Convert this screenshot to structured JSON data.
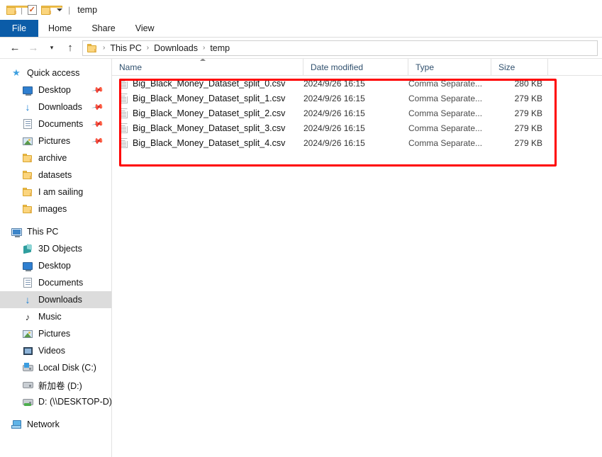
{
  "window": {
    "title": "temp",
    "quick_access_toolbar": [
      {
        "name": "folder-icon",
        "label": ""
      },
      {
        "name": "properties-icon",
        "label": ""
      },
      {
        "name": "new-folder-icon",
        "label": ""
      },
      {
        "name": "customize-dropdown-icon",
        "label": ""
      }
    ]
  },
  "ribbon": {
    "tabs": [
      {
        "label": "File",
        "active": true
      },
      {
        "label": "Home",
        "active": false
      },
      {
        "label": "Share",
        "active": false
      },
      {
        "label": "View",
        "active": false
      }
    ]
  },
  "navbar": {
    "back_tooltip": "Back",
    "forward_tooltip": "Forward",
    "recent_tooltip": "Recent locations",
    "up_tooltip": "Up",
    "breadcrumb": [
      "This PC",
      "Downloads",
      "temp"
    ],
    "separator": "›"
  },
  "sidebar": {
    "sections": [
      {
        "header": {
          "label": "Quick access",
          "icon": "star-icon"
        },
        "items": [
          {
            "label": "Desktop",
            "icon": "monitor-icon",
            "pinned": true,
            "selected": false
          },
          {
            "label": "Downloads",
            "icon": "download-icon",
            "pinned": true,
            "selected": false
          },
          {
            "label": "Documents",
            "icon": "document-icon",
            "pinned": true,
            "selected": false
          },
          {
            "label": "Pictures",
            "icon": "pictures-icon",
            "pinned": true,
            "selected": false
          },
          {
            "label": "archive",
            "icon": "folder-icon",
            "pinned": false,
            "selected": false
          },
          {
            "label": "datasets",
            "icon": "folder-icon",
            "pinned": false,
            "selected": false
          },
          {
            "label": "I am sailing",
            "icon": "folder-icon",
            "pinned": false,
            "selected": false
          },
          {
            "label": "images",
            "icon": "folder-icon",
            "pinned": false,
            "selected": false
          }
        ]
      },
      {
        "header": {
          "label": "This PC",
          "icon": "this-pc-icon"
        },
        "items": [
          {
            "label": "3D Objects",
            "icon": "3d-objects-icon",
            "pinned": false,
            "selected": false
          },
          {
            "label": "Desktop",
            "icon": "monitor-icon",
            "pinned": false,
            "selected": false
          },
          {
            "label": "Documents",
            "icon": "document-icon",
            "pinned": false,
            "selected": false
          },
          {
            "label": "Downloads",
            "icon": "download-icon",
            "pinned": false,
            "selected": true
          },
          {
            "label": "Music",
            "icon": "music-icon",
            "pinned": false,
            "selected": false
          },
          {
            "label": "Pictures",
            "icon": "pictures-icon",
            "pinned": false,
            "selected": false
          },
          {
            "label": "Videos",
            "icon": "videos-icon",
            "pinned": false,
            "selected": false
          },
          {
            "label": "Local Disk (C:)",
            "icon": "windows-disk-icon",
            "pinned": false,
            "selected": false
          },
          {
            "label": "新加卷 (D:)",
            "icon": "disk-icon",
            "pinned": false,
            "selected": false
          },
          {
            "label": "D: (\\\\DESKTOP-D) (H",
            "icon": "network-disk-icon",
            "pinned": false,
            "selected": false
          }
        ]
      },
      {
        "header": {
          "label": "Network",
          "icon": "network-icon"
        },
        "items": []
      }
    ]
  },
  "file_list": {
    "columns": [
      {
        "label": "Name",
        "sorted": "asc"
      },
      {
        "label": "Date modified",
        "sorted": ""
      },
      {
        "label": "Type",
        "sorted": ""
      },
      {
        "label": "Size",
        "sorted": ""
      }
    ],
    "rows": [
      {
        "name": "Big_Black_Money_Dataset_split_0.csv",
        "date": "2024/9/26 16:15",
        "type": "Comma Separate...",
        "size": "280 KB",
        "icon": "csv-file-icon"
      },
      {
        "name": "Big_Black_Money_Dataset_split_1.csv",
        "date": "2024/9/26 16:15",
        "type": "Comma Separate...",
        "size": "279 KB",
        "icon": "csv-file-icon"
      },
      {
        "name": "Big_Black_Money_Dataset_split_2.csv",
        "date": "2024/9/26 16:15",
        "type": "Comma Separate...",
        "size": "279 KB",
        "icon": "csv-file-icon"
      },
      {
        "name": "Big_Black_Money_Dataset_split_3.csv",
        "date": "2024/9/26 16:15",
        "type": "Comma Separate...",
        "size": "279 KB",
        "icon": "csv-file-icon"
      },
      {
        "name": "Big_Black_Money_Dataset_split_4.csv",
        "date": "2024/9/26 16:15",
        "type": "Comma Separate...",
        "size": "279 KB",
        "icon": "csv-file-icon"
      }
    ]
  },
  "annotation": {
    "color": "#ff0000",
    "shape": "rectangle"
  }
}
